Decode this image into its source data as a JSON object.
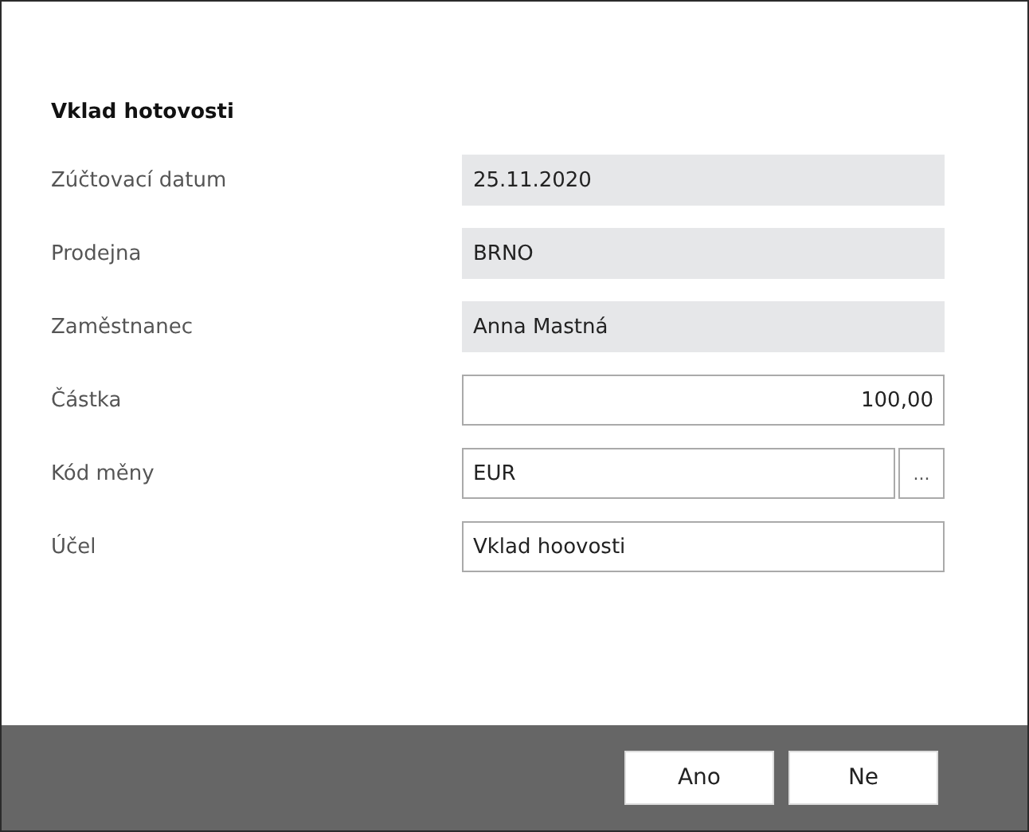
{
  "title": "Vklad hotovosti",
  "fields": [
    {
      "label": "Zúčtovací datum",
      "value": "25.11.2020",
      "kind": "readonly",
      "right_aligned": false
    },
    {
      "label": "Prodejna",
      "value": "BRNO",
      "kind": "readonly",
      "right_aligned": false
    },
    {
      "label": "Zaměstnanec",
      "value": "Anna Mastná",
      "kind": "readonly",
      "right_aligned": false
    },
    {
      "label": "Částka",
      "value": "100,00",
      "kind": "input",
      "right_aligned": true
    },
    {
      "label": "Kód měny",
      "value": "EUR",
      "kind": "lookup",
      "right_aligned": false,
      "lookup_button": "..."
    },
    {
      "label": "Účel",
      "value": "Vklad hoovosti",
      "kind": "input",
      "right_aligned": false
    }
  ],
  "buttons": [
    "Ano",
    "Ne"
  ]
}
